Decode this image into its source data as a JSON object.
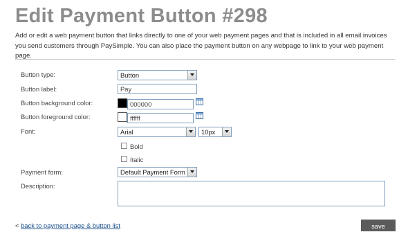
{
  "page": {
    "title": "Edit Payment Button #298",
    "intro": "Add or edit a web payment button that links directly to one of your web payment pages and that is included in all email invoices you send customers through PaySimple. You can also place the payment button on any webpage to link to your web payment page."
  },
  "form": {
    "button_type": {
      "label": "Button type:",
      "value": "Button"
    },
    "button_label": {
      "label": "Button label:",
      "value": "Pay"
    },
    "bg_color": {
      "label": "Button background color:",
      "value": "000000",
      "swatch": "#000000",
      "picker_icon": "color-picker-icon"
    },
    "fg_color": {
      "label": "Button foreground color:",
      "value": "ffffff",
      "swatch": "#ffffff",
      "picker_icon": "color-picker-icon"
    },
    "font": {
      "label": "Font:",
      "family": "Arial",
      "size": "10px"
    },
    "bold": {
      "label": "Bold",
      "checked": false
    },
    "italic": {
      "label": "Italic",
      "checked": false
    },
    "payment_form": {
      "label": "Payment form:",
      "value": "Default Payment Form"
    },
    "description": {
      "label": "Description:",
      "value": ""
    }
  },
  "footer": {
    "back_prefix": "< ",
    "back_link": "back to payment page & button list",
    "save": "save"
  }
}
